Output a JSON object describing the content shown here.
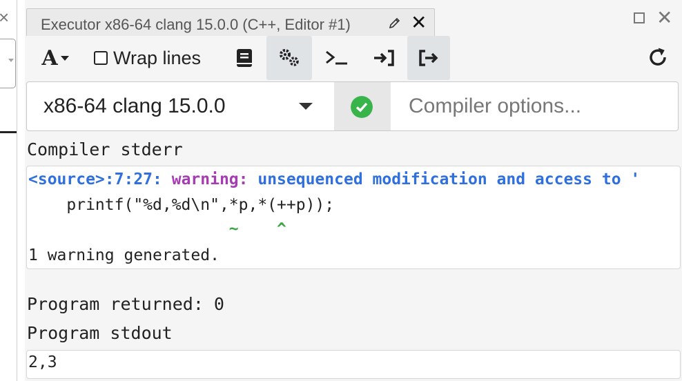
{
  "tab": {
    "title": "Executor x86-64 clang 15.0.0 (C++, Editor #1)"
  },
  "toolbar": {
    "font_icon_label": "A",
    "wrap_lines_label": "Wrap lines"
  },
  "compiler": {
    "selected": "x86-64 clang 15.0.0",
    "options_placeholder": "Compiler options..."
  },
  "output": {
    "stderr_label": "Compiler stderr",
    "warning": {
      "location": "<source>:7:27: ",
      "kind": "warning: ",
      "message": "unsequenced modification and access to '"
    },
    "code_line": "    printf(\"%d,%d\\n\",*p,*(++p));",
    "marker_line": "                     ~    ^",
    "summary": "1 warning generated.",
    "returned": "Program returned: 0",
    "stdout_label": "Program stdout",
    "stdout": "2,3"
  },
  "colors": {
    "location": "#2f6fde",
    "warning": "#a63cb2",
    "marker": "#3aa545",
    "status_ok": "#38b44a",
    "accent": "#3aa37f"
  },
  "icons": [
    "close-icon",
    "edit-icon",
    "maximize-icon",
    "font-icon",
    "book-icon",
    "gears-icon",
    "terminal-icon",
    "input-icon",
    "output-icon",
    "refresh-icon",
    "check-icon"
  ]
}
